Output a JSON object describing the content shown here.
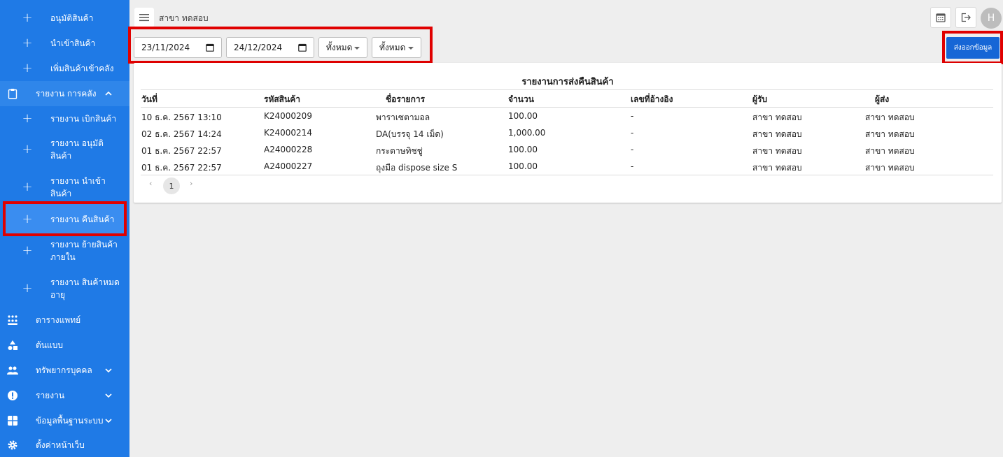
{
  "colors": {
    "sidebar": "#1f7ae6",
    "primary_button": "#1666d6",
    "highlight": "#e00000"
  },
  "sidebar": {
    "sub_items_top": [
      {
        "label": "อนุมัติสินค้า",
        "icon": "plus-icon"
      },
      {
        "label": "นำเข้าสินค้า",
        "icon": "plus-icon"
      },
      {
        "label": "เพิ่มสินค้าเข้าคลัง",
        "icon": "plus-icon"
      }
    ],
    "section": {
      "label": "รายงาน การคลัง",
      "icon": "clipboard-icon",
      "chevron": "chevron-up-icon"
    },
    "report_items": [
      {
        "label": "รายงาน เบิกสินค้า"
      },
      {
        "label": "รายงาน อนุมัติ สินค้า"
      },
      {
        "label": "รายงาน นำเข้า สินค้า"
      },
      {
        "label": "รายงาน คืนสินค้า"
      },
      {
        "label": "รายงาน ย้ายสินค้า ภายใน"
      },
      {
        "label": "รายงาน สินค้าหมด อายุ"
      }
    ],
    "main_items": [
      {
        "label": "ตารางแพทย์",
        "icon": "people-grid-icon"
      },
      {
        "label": "ต้นแบบ",
        "icon": "shapes-icon"
      },
      {
        "label": "ทรัพยากรบุคคล",
        "icon": "group-icon",
        "chevron": "chevron-down-icon"
      },
      {
        "label": "รายงาน",
        "icon": "alert-icon",
        "chevron": "chevron-down-icon"
      },
      {
        "label": "ข้อมูลพื้นฐานระบบ",
        "icon": "grid-icon",
        "chevron": "chevron-down-icon"
      },
      {
        "label": "ตั้งค่าหน้าเว็บ",
        "icon": "gear-icon"
      }
    ]
  },
  "header": {
    "branch": "สาขา ทดสอบ",
    "avatar_letter": "H"
  },
  "filters": {
    "date_from": "23/11/2024",
    "date_to": "24/12/2024",
    "select1": "ทั้งหมด",
    "select2": "ทั้งหมด"
  },
  "export_label": "ส่งออกข้อมูล",
  "report": {
    "title": "รายงานการส่งคืนสินค้า",
    "columns": [
      "วันที่",
      "รหัสสินค้า",
      "ชื่อรายการ",
      "จำนวน",
      "เลขที่อ้างอิง",
      "ผู้รับ",
      "ผู้ส่ง"
    ],
    "rows": [
      [
        "10 ธ.ค. 2567 13:10",
        "K24000209",
        "พาราเซตามอล",
        "100.00",
        "-",
        "สาขา ทดสอบ",
        "สาขา ทดสอบ"
      ],
      [
        "02 ธ.ค. 2567 14:24",
        "K24000214",
        "DA(บรรจุ 14 เม็ด)",
        "1,000.00",
        "-",
        "สาขา ทดสอบ",
        "สาขา ทดสอบ"
      ],
      [
        "01 ธ.ค. 2567 22:57",
        "A24000228",
        "กระดาษทิชชู่",
        "100.00",
        "-",
        "สาขา ทดสอบ",
        "สาขา ทดสอบ"
      ],
      [
        "01 ธ.ค. 2567 22:57",
        "A24000227",
        "ถุงมือ dispose size S",
        "100.00",
        "-",
        "สาขา ทดสอบ",
        "สาขา ทดสอบ"
      ]
    ],
    "pagination": {
      "current": "1",
      "prev": "‹",
      "next": "›"
    }
  }
}
